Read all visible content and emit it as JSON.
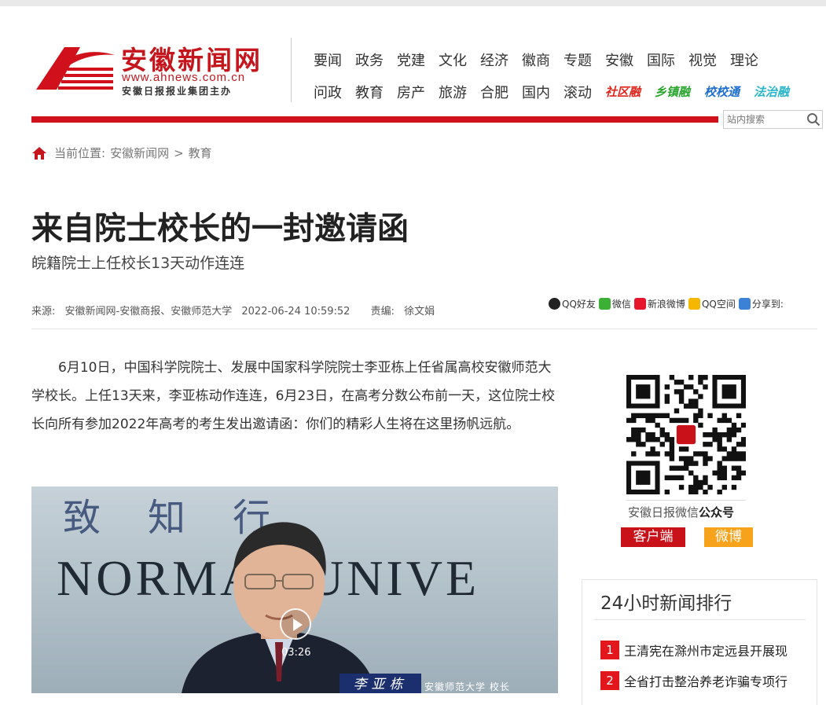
{
  "site": {
    "logo_cn": "安徽新闻网",
    "logo_url": "www.ahnews.com.cn",
    "logo_sub": "安徽日报报业集团主办",
    "brand_color": "#c4161c"
  },
  "nav": {
    "row1": [
      "要闻",
      "政务",
      "党建",
      "文化",
      "经济",
      "徽商",
      "专题",
      "安徽",
      "国际",
      "视觉",
      "理论"
    ],
    "row2": [
      "问政",
      "教育",
      "房产",
      "旅游",
      "合肥",
      "国内",
      "滚动"
    ],
    "special": [
      {
        "label": "社区融",
        "color": "#e2241b"
      },
      {
        "label": "乡镇融",
        "color": "#2aa52e"
      },
      {
        "label": "校校通",
        "color": "#1f6fd1"
      },
      {
        "label": "法治融",
        "color": "#2ab5c9"
      }
    ]
  },
  "search": {
    "placeholder": "站内搜索",
    "icon": "search-icon"
  },
  "breadcrumb": {
    "prefix": "当前位置:",
    "site": "安徽新闻网",
    "sep": ">",
    "section": "教育",
    "icon": "home-icon"
  },
  "article": {
    "title": "来自院士校长的一封邀请函",
    "subtitle": "皖籍院士上任校长13天动作连连",
    "meta": {
      "source_label": "来源:",
      "source": "安徽新闻网-安徽商报、安徽师范大学",
      "datetime": "2022-06-24 10:59:52",
      "editor_label": "责编:",
      "editor": "徐文娟"
    },
    "share": [
      {
        "label": "QQ好友",
        "icon": "qq-icon",
        "color": "#222"
      },
      {
        "label": "微信",
        "icon": "wechat-icon",
        "color": "#3cb034"
      },
      {
        "label": "新浪微博",
        "icon": "weibo-icon",
        "color": "#e6162d"
      },
      {
        "label": "QQ空间",
        "icon": "qzone-icon",
        "color": "#f5b700"
      },
      {
        "label": "分享到:",
        "icon": "plus-icon",
        "color": "#3b82d6"
      }
    ],
    "body": "6月10日，中国科学院院士、发展中国家科学院院士李亚栋上任省属高校安徽师范大学校长。上任13天来，李亚栋动作连连，6月23日，在高考分数公布前一天，这位院士校长向所有参加2022年高考的考生发出邀请函：你们的精彩人生将在这里扬帆远航。",
    "video": {
      "wall_text": "致知行",
      "sign_text": "NORMAL UNIVE",
      "duration": "03:26",
      "caption_name": "李亚栋",
      "caption_role": "安徽师范大学  校长"
    }
  },
  "sidebar": {
    "qr_caption_plain": "安徽日报微信",
    "qr_caption_bold": "公众号",
    "client_button": "客户端",
    "weibo_button": "微博",
    "rank_title": "24小时新闻排行",
    "rank_items": [
      {
        "num": "1",
        "text": "王清宪在滁州市定远县开展现"
      },
      {
        "num": "2",
        "text": "全省打击整治养老诈骗专项行"
      }
    ]
  }
}
